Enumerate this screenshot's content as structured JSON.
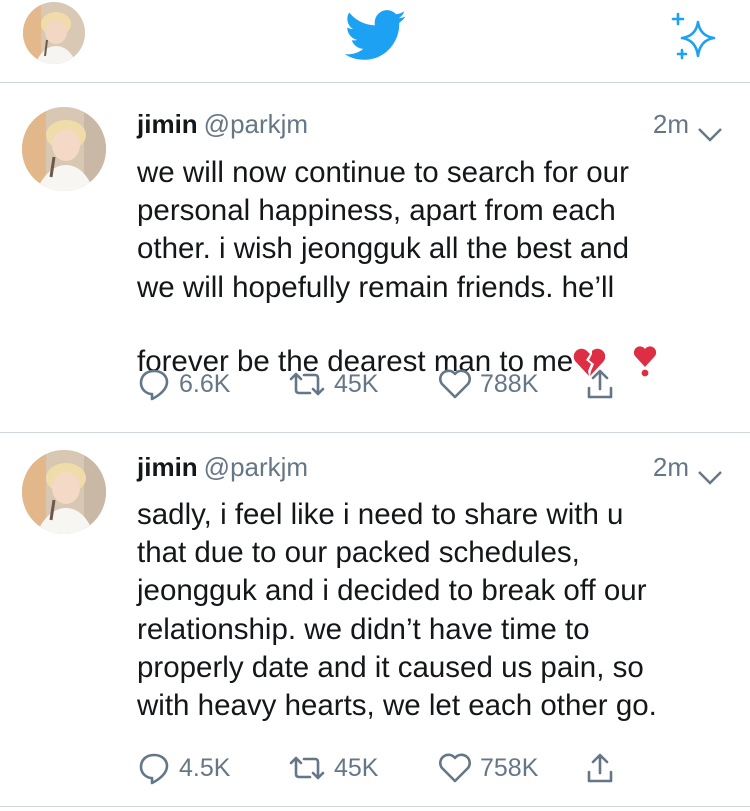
{
  "colors": {
    "brand": "#1da1f2",
    "secondary_text": "#657786",
    "divider": "#cfd6dc"
  },
  "header": {
    "profile_icon": "profile-avatar",
    "logo_icon": "twitter-bird-icon",
    "compose_icon": "sparkle-icon"
  },
  "tweets": [
    {
      "name": "jimin",
      "handle": "@parkjm",
      "time": "2m",
      "text": "we will now continue to search for our\npersonal happiness, apart from each\nother. i wish jeongguk all the best and\nwe will hopefully remain friends. he’ll\nforever be the dearest man to me",
      "emojis": [
        "broken-heart-icon",
        "exclamation-heart-icon"
      ],
      "replies": "6.6K",
      "retweets": "45K",
      "likes": "788K"
    },
    {
      "name": "jimin",
      "handle": "@parkjm",
      "time": "2m",
      "text": "sadly, i feel like i need to share with u\nthat due to our packed schedules,\njeongguk and i decided to break off our\nrelationship. we didn’t have time to\nproperly date and it caused us pain, so\nwith heavy hearts, we let each other go.",
      "emojis": [],
      "replies": "4.5K",
      "retweets": "45K",
      "likes": "758K"
    }
  ]
}
